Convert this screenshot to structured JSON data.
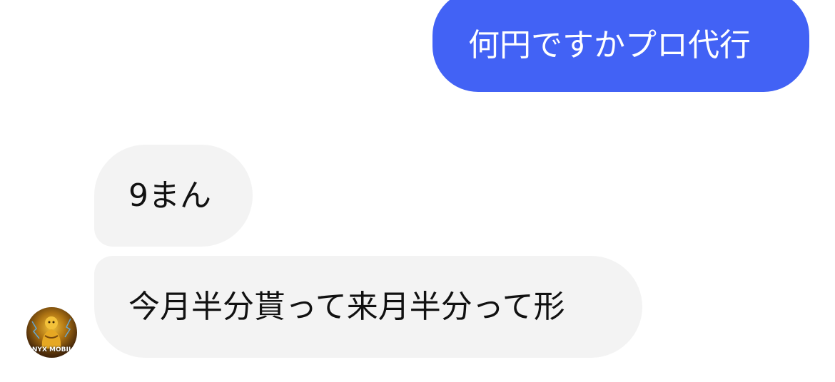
{
  "conversation": {
    "messages": [
      {
        "direction": "outgoing",
        "text": "何円ですかプロ代行"
      },
      {
        "direction": "incoming",
        "text": "9まん"
      },
      {
        "direction": "incoming",
        "text": "今月半分貰って来月半分って形"
      }
    ],
    "contact": {
      "avatar_caption": "ONYX MOBILE"
    }
  },
  "colors": {
    "outgoing_bubble": "#4262f5",
    "incoming_bubble": "#f3f3f3",
    "outgoing_text": "#ffffff",
    "incoming_text": "#111111"
  }
}
